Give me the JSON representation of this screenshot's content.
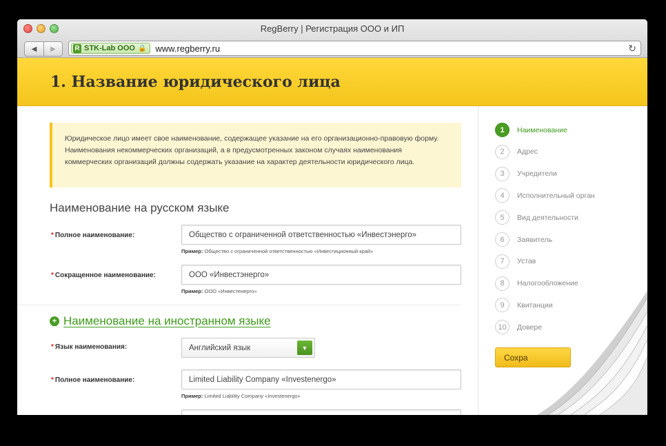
{
  "window": {
    "title": "RegBerry | Регистрация ООО и ИП"
  },
  "toolbar": {
    "back_icon": "◀",
    "forward_icon": "▶",
    "site_logo": "R",
    "site_name": "STK-Lab ООО",
    "lock_icon": "🔒",
    "url": "www.regberry.ru",
    "reload_icon": "↻"
  },
  "header": {
    "title": "1. Название юридического лица"
  },
  "notice": {
    "text": "Юридическое лицо имеет свое наименование, содержащее указание на его организационно-правовую форму. Наименования некоммерческих организаций, а в предусмотренных законом случаях наименования коммерческих организаций должны содержать указание на характер деятельности юридического лица."
  },
  "russian": {
    "title": "Наименование на русском языке",
    "full_label": "Полное наименование:",
    "full_value": "Общество с ограниченной ответственностью «Инвестэнерго»",
    "full_hint_prefix": "Пример:",
    "full_hint": "Общество с ограниченной ответственностью «Инвестиционный край»",
    "short_label": "Сокращенное наименование:",
    "short_value": "ООО «Инвестэнерго»",
    "short_hint_prefix": "Пример:",
    "short_hint": "ООО «Инвестенерго»"
  },
  "foreign": {
    "title": "Наименование на иностранном языке",
    "lang_label": "Язык наименования:",
    "lang_value": "Английский язык",
    "full_label": "Полное наименование:",
    "full_value": "Limited Liability Company «Investenergo»",
    "full_hint_prefix": "Пример:",
    "full_hint": "Limited Liability Company «Investenergo»"
  },
  "required_mark": "*",
  "steps": [
    {
      "num": "1",
      "label": "Наименование",
      "active": true
    },
    {
      "num": "2",
      "label": "Адрес",
      "active": false
    },
    {
      "num": "3",
      "label": "Учредители",
      "active": false
    },
    {
      "num": "4",
      "label": "Исполнительный орган",
      "active": false
    },
    {
      "num": "5",
      "label": "Вид деятельности",
      "active": false
    },
    {
      "num": "6",
      "label": "Заявитель",
      "active": false
    },
    {
      "num": "7",
      "label": "Устав",
      "active": false
    },
    {
      "num": "8",
      "label": "Налогообложение",
      "active": false
    },
    {
      "num": "9",
      "label": "Квитанции",
      "active": false
    },
    {
      "num": "10",
      "label": "Довере",
      "active": false
    }
  ],
  "save_button": "Сохра",
  "colors": {
    "accent_green": "#4a9d24",
    "header_yellow": "#f7ca24"
  }
}
